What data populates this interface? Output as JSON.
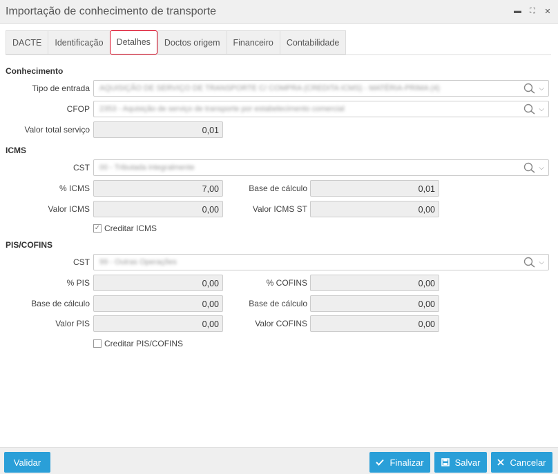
{
  "window": {
    "title": "Importação de conhecimento de transporte",
    "minimize": "▬",
    "maximize": "⛶",
    "close": "✕"
  },
  "tabs": [
    {
      "label": "DACTE"
    },
    {
      "label": "Identificação"
    },
    {
      "label": "Detalhes"
    },
    {
      "label": "Doctos origem"
    },
    {
      "label": "Financeiro"
    },
    {
      "label": "Contabilidade"
    }
  ],
  "active_tab": "Detalhes",
  "conhecimento": {
    "title": "Conhecimento",
    "tipo_entrada_label": "Tipo de entrada",
    "tipo_entrada_value": "AQUISIÇÃO DE SERVIÇO DE TRANSPORTE C/ COMPRA (CREDITA ICMS) - MATÉRIA-PRIMA (4)",
    "cfop_label": "CFOP",
    "cfop_value": "2353 - Aquisição de serviço de transporte por estabelecimento comercial",
    "valor_total_label": "Valor total serviço",
    "valor_total_value": "0,01"
  },
  "icms": {
    "title": "ICMS",
    "cst_label": "CST",
    "cst_value": "00 - Tributada integralmente",
    "pct_label": "% ICMS",
    "pct_value": "7,00",
    "base_label": "Base de cálculo",
    "base_value": "0,01",
    "valor_label": "Valor ICMS",
    "valor_value": "0,00",
    "valor_st_label": "Valor ICMS ST",
    "valor_st_value": "0,00",
    "creditar_label": "Creditar ICMS",
    "creditar_checked": true
  },
  "piscofins": {
    "title": "PIS/COFINS",
    "cst_label": "CST",
    "cst_value": "99 - Outras Operações",
    "pis_pct_label": "% PIS",
    "pis_pct_value": "0,00",
    "cofins_pct_label": "% COFINS",
    "cofins_pct_value": "0,00",
    "base_pis_label": "Base de cálculo",
    "base_pis_value": "0,00",
    "base_cofins_label": "Base de cálculo",
    "base_cofins_value": "0,00",
    "valor_pis_label": "Valor PIS",
    "valor_pis_value": "0,00",
    "valor_cofins_label": "Valor COFINS",
    "valor_cofins_value": "0,00",
    "creditar_label": "Creditar PIS/COFINS",
    "creditar_checked": false
  },
  "footer": {
    "validar": "Validar",
    "finalizar": "Finalizar",
    "salvar": "Salvar",
    "cancelar": "Cancelar"
  },
  "colors": {
    "accent": "#2a9fd8",
    "active_tab_border": "#d9001b"
  }
}
